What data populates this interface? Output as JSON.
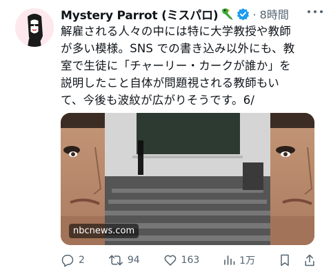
{
  "tweet": {
    "author_name": "Mystery Parrot (ミスパロ)",
    "time_ago": "· 8時間",
    "text": "解雇される人々の中には特に大学教授や教師\nが多い模様。SNS での書き込み以外にも、教\n室で生徒に「チャーリー・カークが誰か」を\n説明したこと自体が問題視される教師もい\nて、今後も波紋が広がりそうです。6/",
    "media_source": "nbcnews.com"
  },
  "actions": {
    "replies": "2",
    "reposts": "94",
    "likes": "163",
    "views": "1万"
  },
  "icons": [
    "more-icon",
    "parrot-icon",
    "verified-icon",
    "reply-icon",
    "repost-icon",
    "like-icon",
    "views-icon",
    "bookmark-icon",
    "share-icon"
  ],
  "colors": {
    "verified": "#1d9bf0",
    "muted": "#536471",
    "text": "#0f1419"
  }
}
